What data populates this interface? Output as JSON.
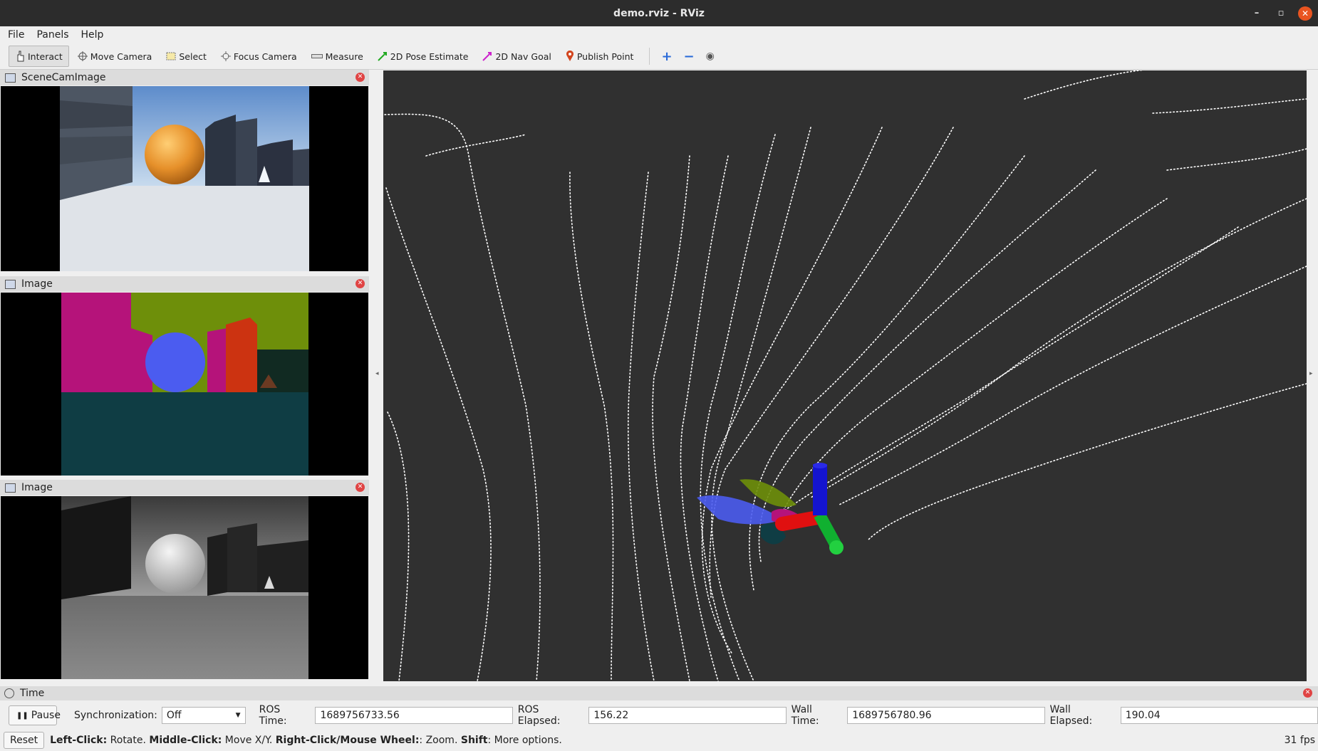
{
  "window": {
    "title": "demo.rviz - RViz",
    "minimize": "–",
    "restore": "▫",
    "close": "✕"
  },
  "menu": {
    "file": "File",
    "panels": "Panels",
    "help": "Help"
  },
  "toolbar": {
    "interact": "Interact",
    "move_camera": "Move Camera",
    "select": "Select",
    "focus_camera": "Focus Camera",
    "measure": "Measure",
    "pose_estimate": "2D Pose Estimate",
    "nav_goal": "2D Nav Goal",
    "publish_point": "Publish Point",
    "add": "+",
    "remove": "−",
    "view": "◉"
  },
  "panels": [
    {
      "title": "SceneCamImage"
    },
    {
      "title": "Image"
    },
    {
      "title": "Image"
    }
  ],
  "time_panel": {
    "title": "Time",
    "pause": "Pause",
    "sync_label": "Synchronization:",
    "sync_value": "Off",
    "ros_time_label": "ROS Time:",
    "ros_time": "1689756733.56",
    "ros_elapsed_label": "ROS Elapsed:",
    "ros_elapsed": "156.22",
    "wall_time_label": "Wall Time:",
    "wall_time": "1689756780.96",
    "wall_elapsed_label": "Wall Elapsed:",
    "wall_elapsed": "190.04"
  },
  "status": {
    "reset": "Reset",
    "left_click": "Left-Click:",
    "left_click_desc": " Rotate. ",
    "middle_click": "Middle-Click:",
    "middle_click_desc": " Move X/Y. ",
    "right_click": "Right-Click/Mouse Wheel:",
    "right_click_desc": ": Zoom. ",
    "shift": "Shift",
    "shift_desc": ": More options.",
    "fps": "31 fps"
  },
  "colors": {
    "viewport_bg": "#303030",
    "axis_x": "#e01010",
    "axis_y": "#10b030",
    "axis_z": "#1414d0",
    "seg_pink": "#b5137a",
    "seg_green": "#6e8f0a",
    "seg_blue": "#4b5cf0",
    "seg_teal": "#0f3d44",
    "seg_red": "#cc3311",
    "ball_orange": "#e6902a"
  }
}
